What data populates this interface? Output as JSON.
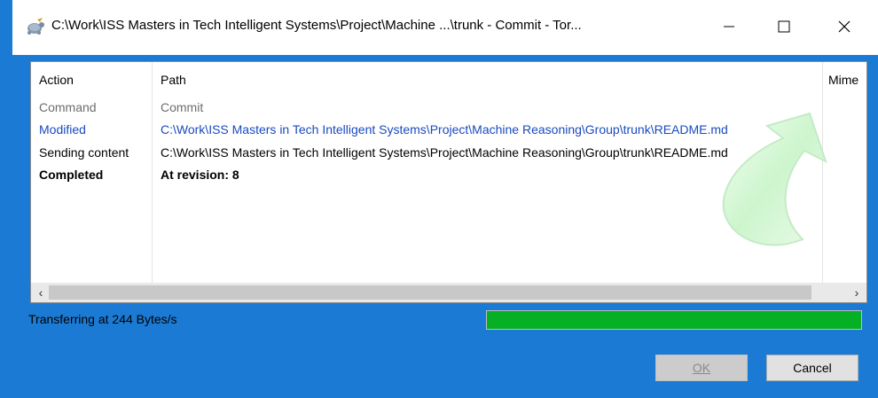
{
  "window": {
    "title": "C:\\Work\\ISS Masters in Tech Intelligent Systems\\Project\\Machine ...\\trunk - Commit - Tor...",
    "app_icon": "tortoisesvn-icon",
    "controls": {
      "minimize_icon": "minimize-icon",
      "maximize_icon": "maximize-icon",
      "close_icon": "close-icon"
    }
  },
  "list": {
    "columns": [
      "Action",
      "Path",
      "Mime"
    ],
    "rows": [
      {
        "action": "Command",
        "path": "Commit",
        "style": "muted"
      },
      {
        "action": "Modified",
        "path": "C:\\Work\\ISS Masters in Tech Intelligent Systems\\Project\\Machine Reasoning\\Group\\trunk\\README.md",
        "style": "blue"
      },
      {
        "action": "Sending content",
        "path": "C:\\Work\\ISS Masters in Tech Intelligent Systems\\Project\\Machine Reasoning\\Group\\trunk\\README.md",
        "style": "normal"
      },
      {
        "action": "Completed",
        "path": "At revision: 8",
        "style": "bold"
      }
    ],
    "scroll_left_icon": "chevron-left-icon",
    "scroll_right_icon": "chevron-right-icon"
  },
  "status": {
    "text": "Transferring at 244 Bytes/s",
    "progress": 1.0,
    "progress_color": "#06b025"
  },
  "buttons": {
    "ok": "OK",
    "ok_accel": "O",
    "cancel": "Cancel"
  }
}
